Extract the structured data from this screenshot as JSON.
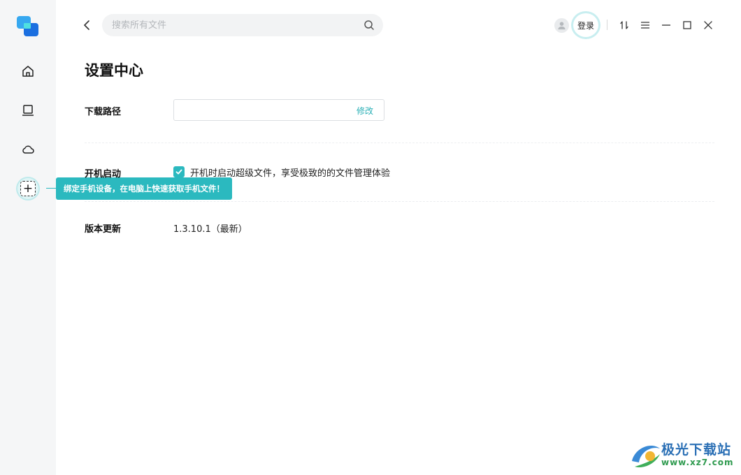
{
  "search": {
    "placeholder": "搜索所有文件"
  },
  "header": {
    "login_label": "登录"
  },
  "tooltip": {
    "text": "绑定手机设备，在电脑上快速获取手机文件！"
  },
  "settings": {
    "title": "设置中心",
    "download_path": {
      "label": "下载路径",
      "value": "",
      "modify_label": "修改"
    },
    "startup": {
      "label": "开机启动",
      "option_text": "开机时启动超级文件，享受极致的的文件管理体验",
      "checked": true
    },
    "version": {
      "label": "版本更新",
      "value": "1.3.10.1（最新）"
    }
  },
  "watermark": {
    "brand": "极光下载站",
    "url": "www.xz7.com"
  },
  "colors": {
    "accent": "#2bb9bf",
    "sidebar_bg": "#f5f6f7"
  }
}
